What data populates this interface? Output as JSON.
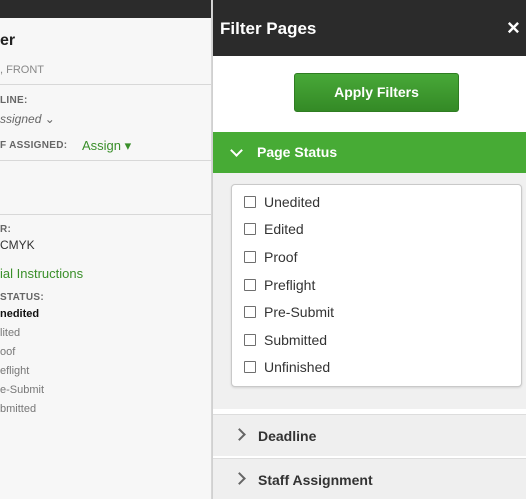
{
  "background_panel": {
    "title_fragment": "er",
    "subtitle_fragment": ", FRONT",
    "deadline_label": "LINE:",
    "deadline_value": "ssigned ⌄",
    "staff_label": "F ASSIGNED:",
    "staff_value": "Assign ▾",
    "color_label": "R:",
    "color_value": "CMYK",
    "instructions_link": "ial Instructions",
    "status_label": "STATUS:",
    "status_items": [
      "nedited",
      "lited",
      "oof",
      "eflight",
      "e-Submit",
      "bmitted"
    ]
  },
  "drawer": {
    "title": "Filter Pages",
    "close_glyph": "×",
    "apply_label": "Apply Filters",
    "sections": {
      "page_status": {
        "label": "Page Status",
        "expanded": true,
        "options": [
          "Unedited",
          "Edited",
          "Proof",
          "Preflight",
          "Pre-Submit",
          "Submitted",
          "Unfinished"
        ]
      },
      "deadline": {
        "label": "Deadline",
        "expanded": false
      },
      "staff_assignment": {
        "label": "Staff Assignment",
        "expanded": false
      }
    }
  },
  "colors": {
    "header_dark": "#2b2b2b",
    "accent_green": "#47ab35",
    "button_green": "#3c9a2d",
    "section_gray": "#efefef"
  },
  "icons": {
    "close": "close-icon",
    "expanded": "chevron-down-icon",
    "collapsed": "chevron-right-icon"
  }
}
